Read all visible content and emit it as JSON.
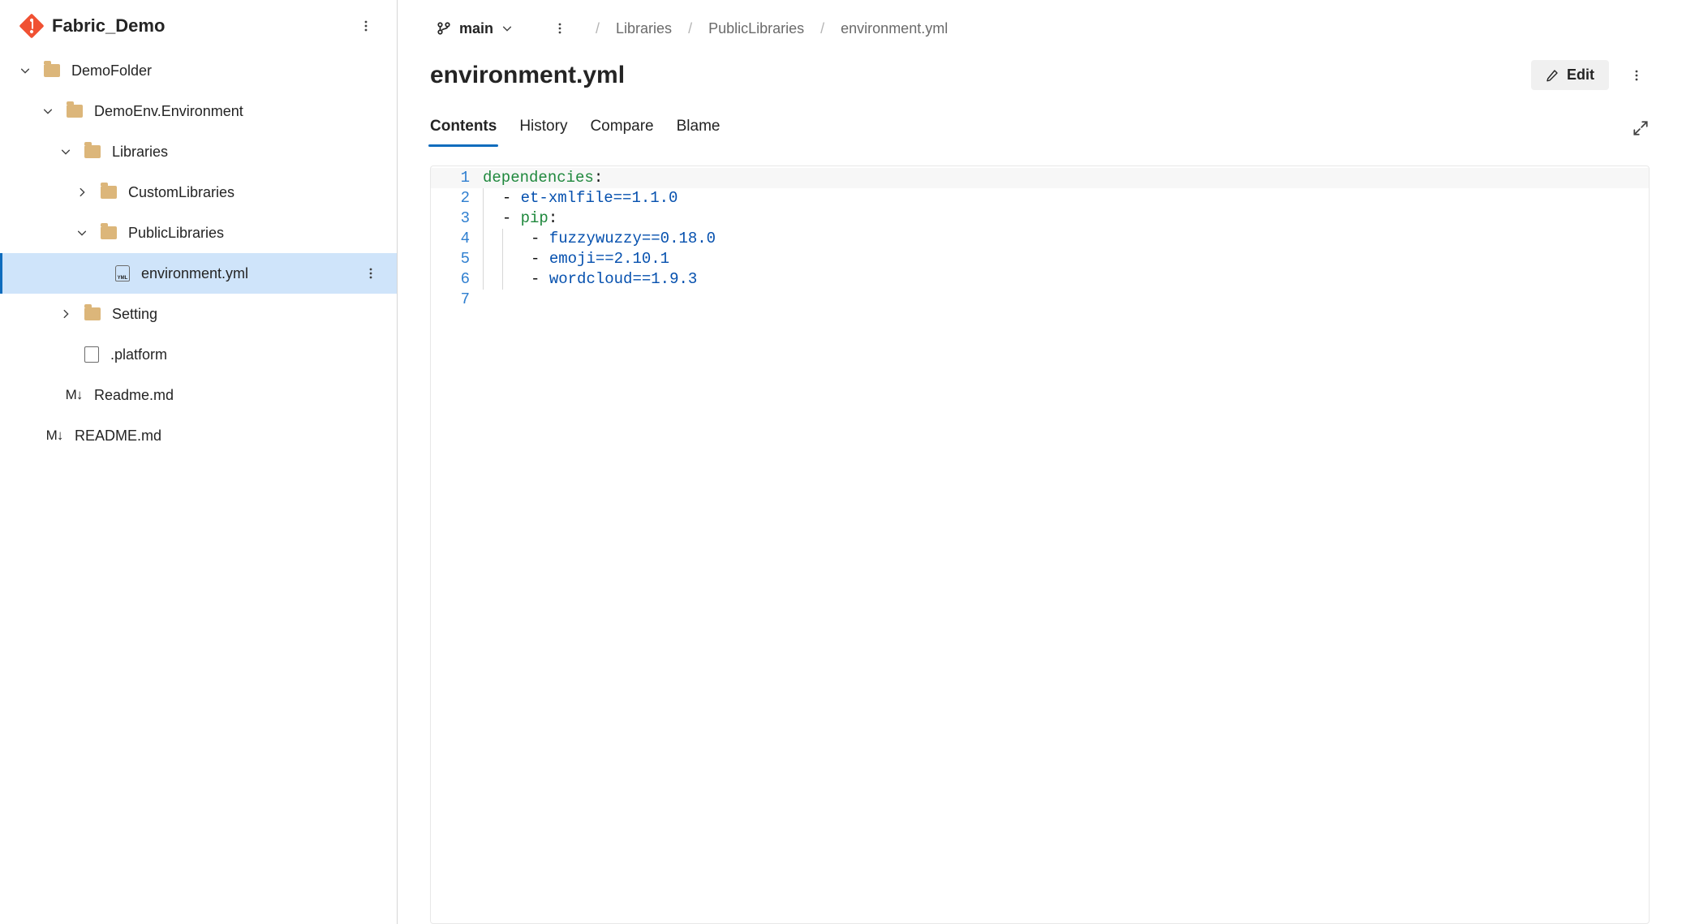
{
  "repo": {
    "name": "Fabric_Demo"
  },
  "tree": {
    "demoFolder": "DemoFolder",
    "demoEnv": "DemoEnv.Environment",
    "libraries": "Libraries",
    "custom": "CustomLibraries",
    "public": "PublicLibraries",
    "envFile": "environment.yml",
    "setting": "Setting",
    "platform": ".platform",
    "readmeLower": "Readme.md",
    "readmeUpper": "README.md"
  },
  "branch": {
    "name": "main"
  },
  "breadcrumbs": {
    "lib": "Libraries",
    "pub": "PublicLibraries",
    "file": "environment.yml"
  },
  "fileTitle": "environment.yml",
  "editLabel": "Edit",
  "tabs": {
    "contents": "Contents",
    "history": "History",
    "compare": "Compare",
    "blame": "Blame"
  },
  "code": {
    "l1a": "dependencies",
    "l1b": ":",
    "l2v": "et-xmlfile==1.1.0",
    "l3a": "pip",
    "l3b": ":",
    "l4v": "fuzzywuzzy==0.18.0",
    "l5v": "emoji==2.10.1",
    "l6v": "wordcloud==1.9.3",
    "n1": "1",
    "n2": "2",
    "n3": "3",
    "n4": "4",
    "n5": "5",
    "n6": "6",
    "n7": "7"
  }
}
